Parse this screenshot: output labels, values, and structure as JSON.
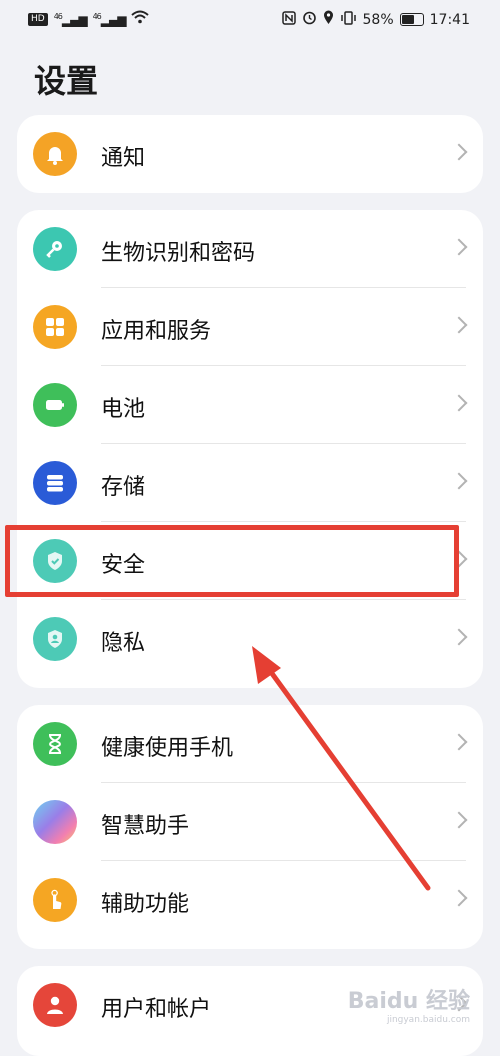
{
  "status_bar": {
    "left": [
      "HD",
      "46",
      "46"
    ],
    "battery": "58%",
    "time": "17:41"
  },
  "page_title": "设置",
  "groups": [
    {
      "items": [
        {
          "label": "通知",
          "icon": "bell-icon",
          "color": "#f4a326"
        }
      ]
    },
    {
      "items": [
        {
          "label": "生物识别和密码",
          "icon": "key-icon",
          "color": "#3cc7b1"
        },
        {
          "label": "应用和服务",
          "icon": "apps-icon",
          "color": "#f5a623"
        },
        {
          "label": "电池",
          "icon": "battery-icon",
          "color": "#3fbf5a"
        },
        {
          "label": "存储",
          "icon": "storage-icon",
          "color": "#2a5bd7"
        },
        {
          "label": "安全",
          "icon": "shield-icon",
          "color": "#4dcab6"
        },
        {
          "label": "隐私",
          "icon": "privacy-icon",
          "color": "#4dcab6"
        }
      ]
    },
    {
      "items": [
        {
          "label": "健康使用手机",
          "icon": "hourglass-icon",
          "color": "#3fbf5a"
        },
        {
          "label": "智慧助手",
          "icon": "assistant-icon",
          "color": "#9a7ee8"
        },
        {
          "label": "辅助功能",
          "icon": "hand-icon",
          "color": "#f5a623"
        }
      ]
    },
    {
      "items": [
        {
          "label": "用户和帐户",
          "icon": "user-icon",
          "color": "#e5463a"
        }
      ]
    }
  ],
  "annotation_color": "#e53f33",
  "watermark": {
    "main": "Baidu 经验",
    "sub": "jingyan.baidu.com"
  }
}
